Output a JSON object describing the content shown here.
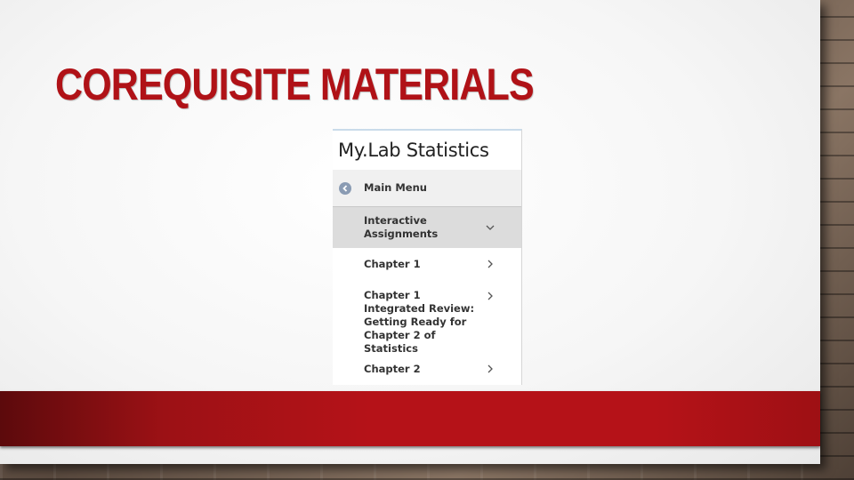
{
  "slide": {
    "title": "COREQUISITE MATERIALS"
  },
  "mylab": {
    "app_title": "My.Lab Statistics",
    "main_menu_label": "Main Menu",
    "items": [
      {
        "label": "Interactive Assignments",
        "icon": "chevron-down-icon",
        "active": true
      },
      {
        "label": "Chapter 1",
        "icon": "chevron-right-icon",
        "active": false
      },
      {
        "label": "Chapter 1 Integrated Review: Getting Ready for Chapter 2 of Statistics",
        "icon": "chevron-right-icon",
        "active": false
      },
      {
        "label": "Chapter 2",
        "icon": "chevron-right-icon",
        "active": false
      }
    ]
  },
  "colors": {
    "title_red": "#b01217",
    "band_red": "#b51218",
    "back_icon_blue": "#8a9bb3",
    "active_row_gray": "#dcdcdc"
  }
}
